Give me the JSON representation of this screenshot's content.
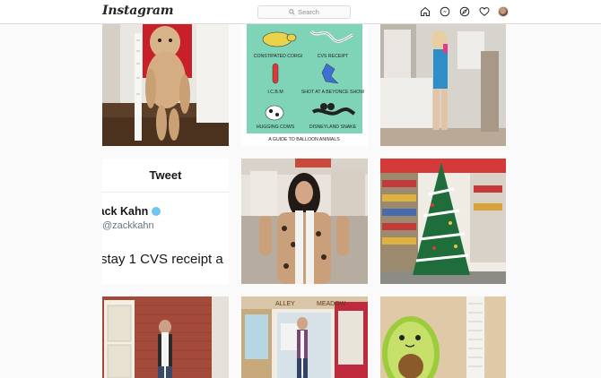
{
  "header": {
    "logo": "Instagram",
    "search_placeholder": "Search",
    "icons": [
      "home-icon",
      "messenger-icon",
      "explore-icon",
      "heart-icon",
      "profile-avatar"
    ]
  },
  "posts": {
    "balloon_labels": [
      "CONSTIPATED CORGI",
      "CVS RECEIPT",
      "I.C.B.M",
      "SHOT AT A BEYONCE SHOW",
      "HUGGING COWS",
      "DISNEYLAND SNAKE"
    ],
    "balloon_caption": "A GUIDE TO BALLOON ANIMALS",
    "tweet": {
      "title": "Tweet",
      "name": "Zack Kahn",
      "handle": "@zackkahn",
      "text": "stay 1 CVS receipt a"
    },
    "storefront_signs": [
      "ALLEY",
      "MEADOW"
    ]
  },
  "colors": {
    "header_bg": "#ffffff",
    "page_bg": "#fafafa",
    "border": "#dbdbdb",
    "balloon_panel": "#7fd4b8"
  }
}
